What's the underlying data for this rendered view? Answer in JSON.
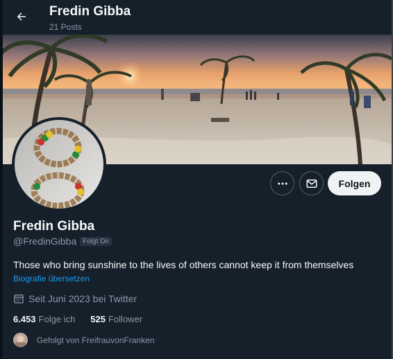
{
  "header": {
    "title": "Fredin Gibba",
    "posts_count": "21 Posts"
  },
  "profile": {
    "display_name": "Fredin Gibba",
    "handle": "@FredinGibba",
    "follows_you_badge": "Folgt Dir",
    "bio": "Those who bring sunshine to the lives of others cannot keep it from themselves",
    "translate_link": "Biografie übersetzen",
    "joined": "Seit Juni 2023 bei Twitter",
    "following_count": "6.453",
    "following_label": "Folge ich",
    "followers_count": "525",
    "followers_label": "Follower",
    "followed_by": "Gefolgt von FreifrauvonFranken"
  },
  "actions": {
    "follow_label": "Folgen",
    "more_icon": "more-horizontal-icon",
    "message_icon": "envelope-icon",
    "back_icon": "arrow-left-icon"
  },
  "colors": {
    "background": "#15202b",
    "accent": "#1d9bf0",
    "secondary_text": "#8b98a5"
  }
}
